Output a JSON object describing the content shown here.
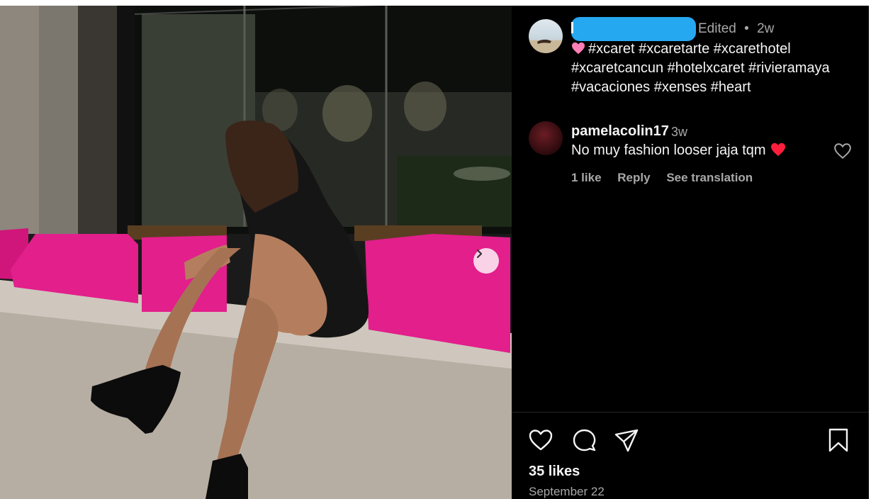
{
  "post": {
    "meta_edited": "Edited",
    "meta_separator": "•",
    "meta_age": "2w",
    "caption_text": "#xcaret #xcaretarte #xcarethotel #xcaretcancun #hotelxcaret #rivieramaya #vacaciones #xenses #heart",
    "likes": "35 likes",
    "date": "September 22"
  },
  "comment": {
    "username": "pamelacolin17",
    "age": "3w",
    "text": "No muy fashion looser jaja tqm",
    "likes": "1 like",
    "reply": "Reply",
    "translate": "See translation"
  },
  "icons": {
    "caption_emoji": "pink-heart-icon",
    "comment_emoji": "red-heart-icon",
    "comment_like": "heart-outline-icon",
    "like": "heart-outline-icon",
    "comment": "comment-bubble-icon",
    "share": "send-arrow-icon",
    "save": "bookmark-icon",
    "next": "chevron-right-icon"
  },
  "colors": {
    "background": "#000000",
    "primary_text": "#f5f5f5",
    "secondary_text": "#a8a8a8",
    "redaction": "#25a8f0",
    "pink_heart": "#ff7eb6",
    "red_heart": "#ff1f3d"
  }
}
